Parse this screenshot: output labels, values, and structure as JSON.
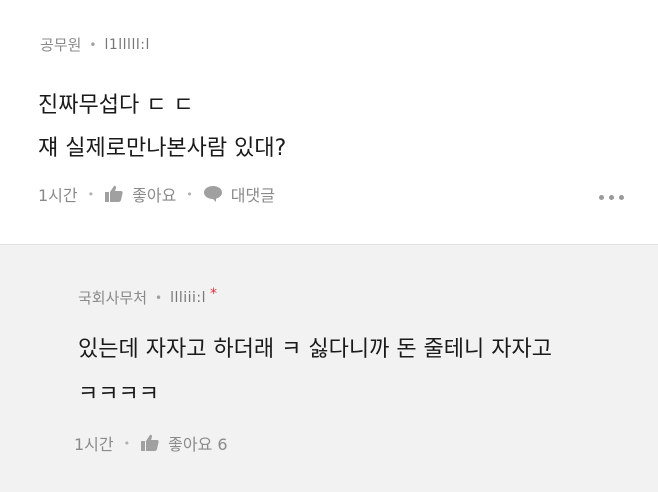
{
  "comment1": {
    "author": "공무원",
    "rank": "l1lllll:l",
    "lines": [
      "진짜무섭다 ㄷ ㄷ",
      "쟤 실제로만나본사람 있대?"
    ],
    "time": "1시간",
    "like_label": "좋아요",
    "reply_label": "대댓글"
  },
  "comment2": {
    "author": "국회사무처",
    "rank": "llliii:l",
    "lines": [
      "있는데 자자고 하더래 ㅋ 싫다니까 돈 줄테니 자자고",
      "ㅋㅋㅋㅋ"
    ],
    "time": "1시간",
    "like_label": "좋아요 6"
  },
  "colors": {
    "reply_background": "#f2f2f2",
    "meta_text": "#8a8a8a",
    "star": "#e0323c"
  }
}
